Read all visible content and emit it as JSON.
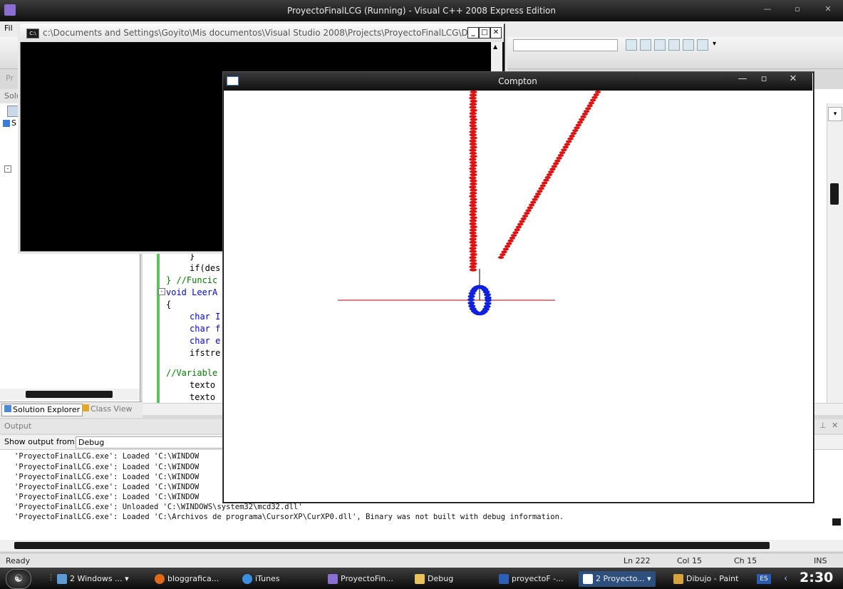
{
  "vs_window": {
    "title": "ProyectoFinalLCG (Running) - Visual C++ 2008 Express Edition",
    "menu_fragment": "Fil",
    "solution_header": "Solu",
    "solution_item": "S",
    "toolbar_fragment": "Pr",
    "tabs": {
      "solution_explorer": "Solution Explorer",
      "class_view": "Class View"
    }
  },
  "editor": {
    "lines": [
      {
        "text": "}",
        "type": "plain"
      },
      {
        "text": "if(des",
        "type": "plain"
      },
      {
        "text": "} //Funcic",
        "type": "comment"
      },
      {
        "text": "void LeerA",
        "type": "keyword"
      },
      {
        "text": "{",
        "type": "plain"
      },
      {
        "text": "char I",
        "type": "keyword"
      },
      {
        "text": "char f",
        "type": "keyword"
      },
      {
        "text": "char e",
        "type": "keyword"
      },
      {
        "text": "ifstre",
        "type": "plain"
      },
      {
        "text": "",
        "type": "plain"
      },
      {
        "text": "//Variable",
        "type": "comment"
      },
      {
        "text": "texto",
        "type": "plain"
      },
      {
        "text": "texto",
        "type": "plain"
      }
    ]
  },
  "output": {
    "header": "Output",
    "show_from_label": "Show output from:",
    "show_from_value": "Debug",
    "lines": [
      "'ProyectoFinalLCG.exe': Loaded 'C:\\WINDOW",
      "'ProyectoFinalLCG.exe': Loaded 'C:\\WINDOW",
      "'ProyectoFinalLCG.exe': Loaded 'C:\\WINDOW",
      "'ProyectoFinalLCG.exe': Loaded 'C:\\WINDOW",
      "'ProyectoFinalLCG.exe': Loaded 'C:\\WINDOW",
      "'ProyectoFinalLCG.exe': Unloaded 'C:\\WINDOWS\\system32\\mcd32.dll'",
      "'ProyectoFinalLCG.exe': Loaded 'C:\\Archivos de programa\\CursorXP\\CurXP0.dll', Binary was not built with debug information."
    ]
  },
  "status_bar": {
    "state": "Ready",
    "line": "Ln 222",
    "col": "Col 15",
    "ch": "Ch 15",
    "mode": "INS"
  },
  "console_window": {
    "title": "c:\\Documents and Settings\\Goyito\\Mis documentos\\Visual Studio 2008\\Projects\\ProyectoFinalLCG\\Debug\\...",
    "icon_text": "C:\\"
  },
  "compton_window": {
    "title": "Compton",
    "colors": {
      "photon_dots": "#e01010",
      "electron_ring": "#1020e0",
      "axis_line": "#b00000",
      "stem_line": "#000000"
    }
  },
  "taskbar": {
    "items": [
      {
        "label": "2 Windows ...",
        "icon": "windows-group-icon"
      },
      {
        "label": "bloggrafica...",
        "icon": "firefox-icon"
      },
      {
        "label": "iTunes",
        "icon": "itunes-icon"
      },
      {
        "label": "ProyectoFin...",
        "icon": "visual-studio-icon"
      },
      {
        "label": "Debug",
        "icon": "folder-icon"
      },
      {
        "label": "proyectoF -...",
        "icon": "word-icon"
      },
      {
        "label": "2 Proyecto...",
        "icon": "window-group-icon"
      },
      {
        "label": "Dibujo - Paint",
        "icon": "paint-icon"
      }
    ],
    "language": "ES",
    "clock": "2:30"
  }
}
